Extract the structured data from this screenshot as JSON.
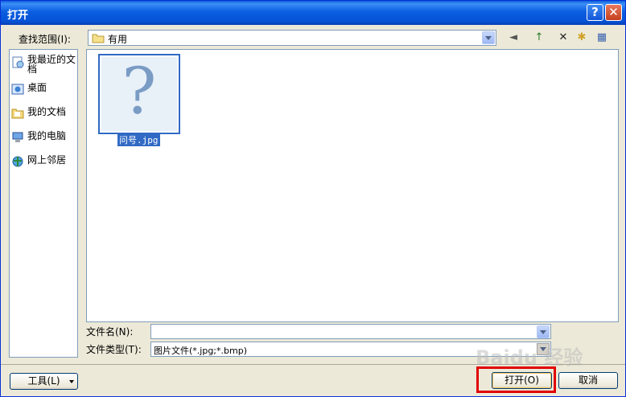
{
  "window": {
    "title": "打开",
    "help_glyph": "?",
    "close_glyph": "✕"
  },
  "lookin": {
    "label": "查找范围(I):",
    "value": "有用"
  },
  "toolbar": {
    "back_glyph": "◄",
    "up_glyph": "↑",
    "delete_glyph": "✕",
    "newfolder_glyph": "✱",
    "views_glyph": "▦"
  },
  "places": [
    {
      "label": "我最近的文档",
      "icon": "recent-docs-icon"
    },
    {
      "label": "桌面",
      "icon": "desktop-icon"
    },
    {
      "label": "我的文档",
      "icon": "my-documents-icon"
    },
    {
      "label": "我的电脑",
      "icon": "my-computer-icon"
    },
    {
      "label": "网上邻居",
      "icon": "network-places-icon"
    }
  ],
  "files": [
    {
      "name": "问号.jpg",
      "glyph": "?",
      "selected": true
    }
  ],
  "filename": {
    "label": "文件名(N):",
    "value": ""
  },
  "filetype": {
    "label": "文件类型(T):",
    "value": "图片文件(*.jpg;*.bmp)"
  },
  "buttons": {
    "tools": "工具(L)",
    "open": "打开(O)",
    "cancel": "取消"
  },
  "watermark": "Baidu 经验",
  "colors": {
    "title_bar": "#0653d6",
    "selection": "#316ac5",
    "highlight_box": "#e10000",
    "dialog_bg": "#ece9d8"
  }
}
